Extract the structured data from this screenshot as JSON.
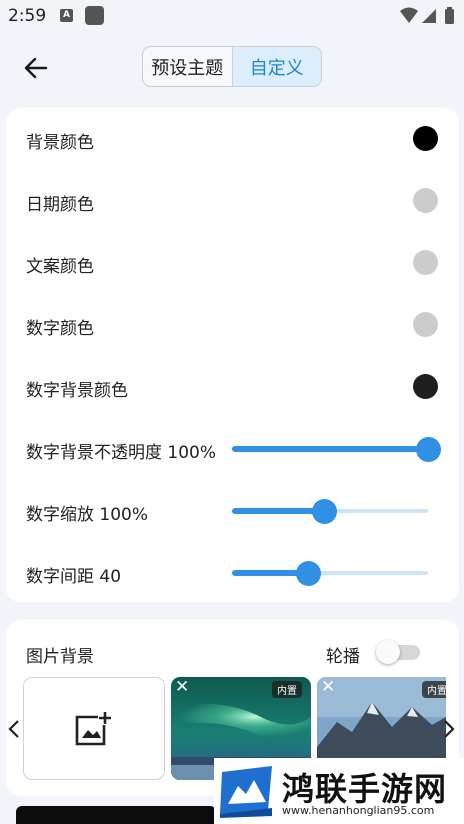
{
  "status_bar": {
    "time": "2:59",
    "a_icon": "A"
  },
  "header": {
    "back_icon": "arrow-left-icon",
    "tabs": [
      {
        "label": "预设主题",
        "active": false
      },
      {
        "label": "自定义",
        "active": true
      }
    ]
  },
  "settings": {
    "colors": [
      {
        "label": "背景颜色",
        "swatch": "#000000"
      },
      {
        "label": "日期颜色",
        "swatch": "#cccccc"
      },
      {
        "label": "文案颜色",
        "swatch": "#cccccc"
      },
      {
        "label": "数字颜色",
        "swatch": "#cccccc"
      },
      {
        "label": "数字背景颜色",
        "swatch": "#1f1f1f"
      }
    ],
    "sliders": [
      {
        "label": "数字背景不透明度 100%",
        "value": 1.0
      },
      {
        "label": "数字缩放 100%",
        "value": 0.47
      },
      {
        "label": "数字间距 40",
        "value": 0.39
      }
    ]
  },
  "image_bg": {
    "title": "图片背景",
    "loop_label": "轮播",
    "loop_on": false,
    "tiles": [
      {
        "badge": "内置",
        "close": "✕"
      },
      {
        "badge": "内置",
        "close": "✕"
      }
    ]
  },
  "watermark": {
    "text": "鸿联手游网",
    "url": "www.henanhonglian95.com"
  },
  "accent_color": "#2f90e6"
}
